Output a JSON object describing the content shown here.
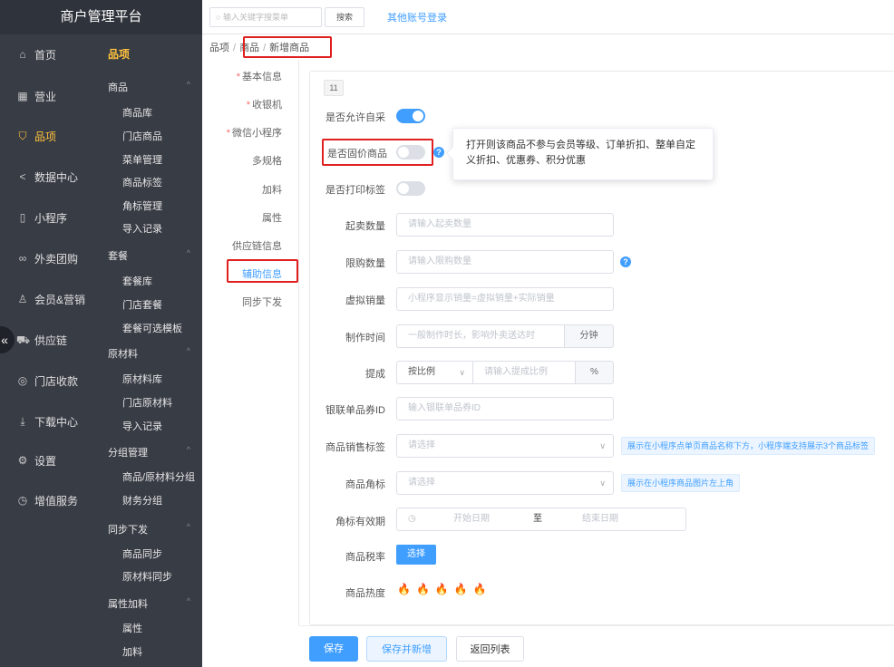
{
  "app": {
    "title": "商户管理平台"
  },
  "nav": [
    {
      "label": "首页",
      "icon": "home-icon",
      "glyph": "⌂"
    },
    {
      "label": "营业",
      "icon": "calendar-icon",
      "glyph": "▦"
    },
    {
      "label": "品项",
      "icon": "bag-icon",
      "glyph": "⛉"
    },
    {
      "label": "数据中心",
      "icon": "share-icon",
      "glyph": "<"
    },
    {
      "label": "小程序",
      "icon": "phone-icon",
      "glyph": "▯"
    },
    {
      "label": "外卖团购",
      "icon": "people-icon",
      "glyph": "∞"
    },
    {
      "label": "会员&营销",
      "icon": "user-icon",
      "glyph": "♙"
    },
    {
      "label": "供应链",
      "icon": "truck-icon",
      "glyph": "⛟"
    },
    {
      "label": "门店收款",
      "icon": "wallet-icon",
      "glyph": "◎"
    },
    {
      "label": "下载中心",
      "icon": "download-icon",
      "glyph": "⤓"
    },
    {
      "label": "设置",
      "icon": "gear-icon",
      "glyph": "⚙"
    },
    {
      "label": "增值服务",
      "icon": "service-icon",
      "glyph": "◷"
    }
  ],
  "submenu": {
    "head": "品项",
    "groups": [
      {
        "label": "商品",
        "items": [
          "商品库",
          "门店商品",
          "菜单管理",
          "商品标签",
          "角标管理",
          "导入记录"
        ]
      },
      {
        "label": "套餐",
        "items": [
          "套餐库",
          "门店套餐",
          "套餐可选模板"
        ]
      },
      {
        "label": "原材料",
        "items": [
          "原材料库",
          "门店原材料",
          "导入记录"
        ]
      },
      {
        "label": "分组管理",
        "items": [
          "商品/原材料分组",
          "财务分组"
        ]
      },
      {
        "label": "同步下发",
        "items": [
          "商品同步",
          "原材料同步"
        ]
      },
      {
        "label": "属性加料",
        "items": [
          "属性",
          "加料"
        ]
      }
    ]
  },
  "topbar": {
    "search_placeholder": "输入关键字搜菜单",
    "search_button": "搜索",
    "other_login": "其他账号登录"
  },
  "breadcrumb": [
    "品项",
    "商品",
    "新增商品"
  ],
  "tabs": [
    {
      "label": "基本信息",
      "required": true
    },
    {
      "label": "收银机",
      "required": true
    },
    {
      "label": "微信小程序",
      "required": true
    },
    {
      "label": "多规格",
      "required": false
    },
    {
      "label": "加料",
      "required": false
    },
    {
      "label": "属性",
      "required": false
    },
    {
      "label": "供应链信息",
      "required": false
    },
    {
      "label": "辅助信息",
      "required": false,
      "active": true
    },
    {
      "label": "同步下发",
      "required": false
    }
  ],
  "form": {
    "tag": "11",
    "self_purchase": {
      "label": "是否允许自采",
      "on": true
    },
    "fixed_price": {
      "label": "是否固价商品",
      "on": false
    },
    "print_label": {
      "label": "是否打印标签",
      "on": false
    },
    "tooltip": "打开则该商品不参与会员等级、订单折扣、整单自定义折扣、优惠券、积分优惠",
    "min_qty": {
      "label": "起卖数量",
      "placeholder": "请输入起卖数量"
    },
    "limit_qty": {
      "label": "限购数量",
      "placeholder": "请输入限购数量"
    },
    "virtual_sales": {
      "label": "虚拟销量",
      "placeholder": "小程序显示销量=虚拟销量+实际销量"
    },
    "make_time": {
      "label": "制作时间",
      "placeholder": "一般制作时长，影响外卖送达时",
      "unit": "分钟"
    },
    "commission": {
      "label": "提成",
      "mode": "按比例",
      "placeholder": "请输入提成比例",
      "unit": "%"
    },
    "unionpay_id": {
      "label": "银联单品券ID",
      "placeholder": "输入银联单品券ID"
    },
    "sales_tag": {
      "label": "商品销售标签",
      "placeholder": "请选择",
      "hint": "展示在小程序点单页商品名称下方，小程序端支持展示3个商品标签"
    },
    "corner_mark": {
      "label": "商品角标",
      "placeholder": "请选择",
      "hint": "展示在小程序商品图片左上角"
    },
    "corner_period": {
      "label": "角标有效期",
      "start": "开始日期",
      "to": "至",
      "end": "结束日期"
    },
    "tax_rate": {
      "label": "商品税率",
      "button": "选择"
    },
    "heat": {
      "label": "商品热度",
      "flames": "🔥🔥🔥🔥🔥"
    }
  },
  "footer": {
    "save": "保存",
    "save_new": "保存并新增",
    "back": "返回列表"
  },
  "colors": {
    "sidebar": "#383c45",
    "accent": "#409eff",
    "active_nav": "#ffc23d",
    "highlight": "#e02020"
  }
}
